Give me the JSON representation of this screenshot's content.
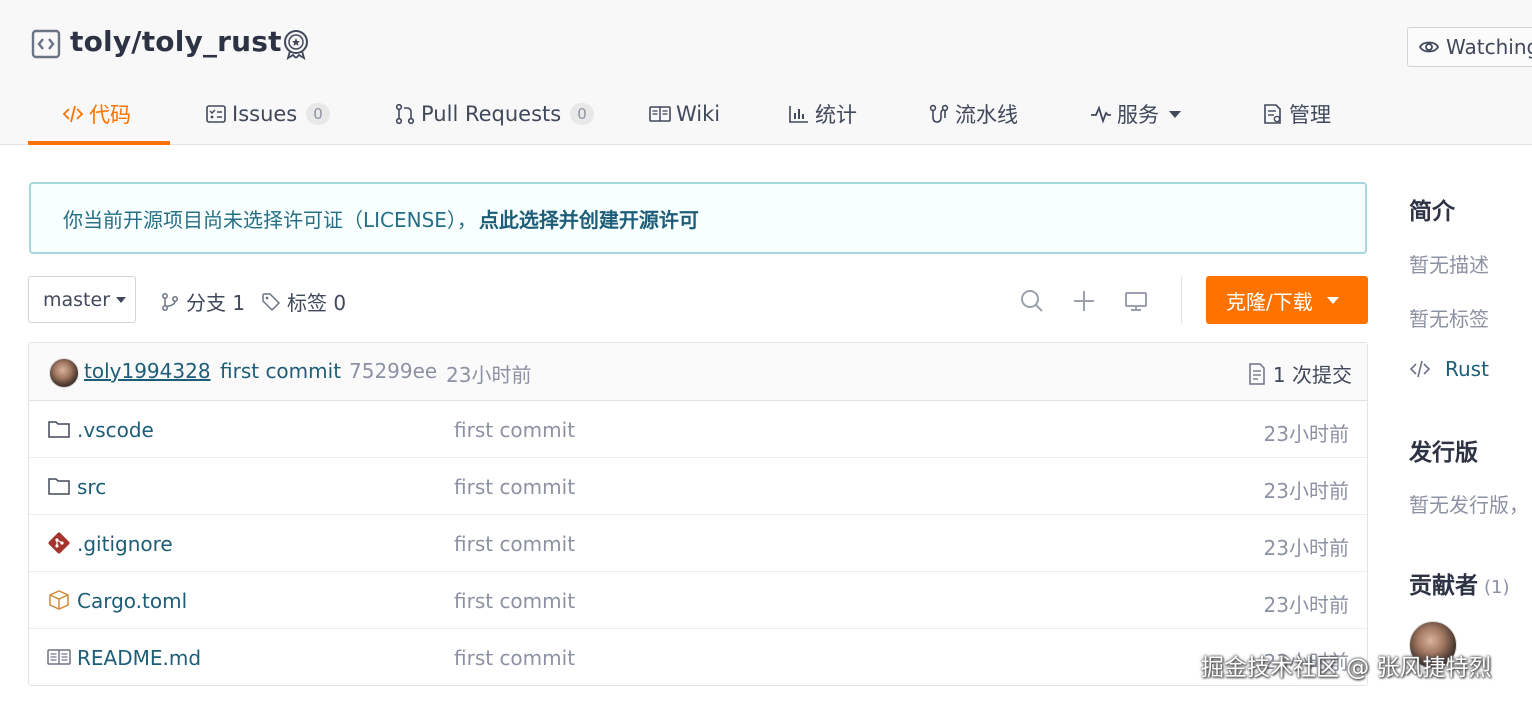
{
  "repo": {
    "name": "toly/toly_rust"
  },
  "watch": {
    "label": "Watching"
  },
  "tabs": [
    {
      "label": "代码",
      "icon": "code-icon"
    },
    {
      "label": "Issues",
      "count": "0",
      "icon": "issues-icon"
    },
    {
      "label": "Pull Requests",
      "count": "0",
      "icon": "pull-request-icon"
    },
    {
      "label": "Wiki",
      "icon": "wiki-icon"
    },
    {
      "label": "统计",
      "icon": "chart-icon"
    },
    {
      "label": "流水线",
      "icon": "pipeline-icon"
    },
    {
      "label": "服务",
      "icon": "pulse-icon"
    },
    {
      "label": "管理",
      "icon": "manage-icon"
    }
  ],
  "notice": {
    "text": "你当前开源项目尚未选择许可证（LICENSE），",
    "link": "点此选择并创建开源许可"
  },
  "toolbar": {
    "branch": "master",
    "branches": "分支 1",
    "tags": "标签 0",
    "clone_label": "克隆/下载"
  },
  "commit": {
    "author": "toly1994328",
    "message": "first commit",
    "sha": "75299ee",
    "time": "23小时前",
    "count": "1 次提交"
  },
  "files": [
    {
      "name": ".vscode",
      "type": "folder",
      "icon": "folder-icon",
      "message": "first commit",
      "time": "23小时前"
    },
    {
      "name": "src",
      "type": "folder",
      "icon": "folder-icon",
      "message": "first commit",
      "time": "23小时前"
    },
    {
      "name": ".gitignore",
      "type": "git",
      "icon": "git-icon",
      "message": "first commit",
      "time": "23小时前"
    },
    {
      "name": "Cargo.toml",
      "type": "package",
      "icon": "package-icon",
      "message": "first commit",
      "time": "23小时前"
    },
    {
      "name": "README.md",
      "type": "readme",
      "icon": "book-icon",
      "message": "first commit",
      "time": "23小时前"
    }
  ],
  "sidebar": {
    "intro_title": "简介",
    "no_description": "暂无描述",
    "no_tags": "暂无标签",
    "language": "Rust",
    "release_title": "发行版",
    "no_release": "暂无发行版，",
    "contributors_title": "贡献者",
    "contributors_count": "(1)"
  },
  "watermark": "掘金技术社区 @ 张风捷特烈",
  "colors": {
    "accent": "#fe7300",
    "link": "#1e5d78",
    "muted": "#8c92a4"
  }
}
